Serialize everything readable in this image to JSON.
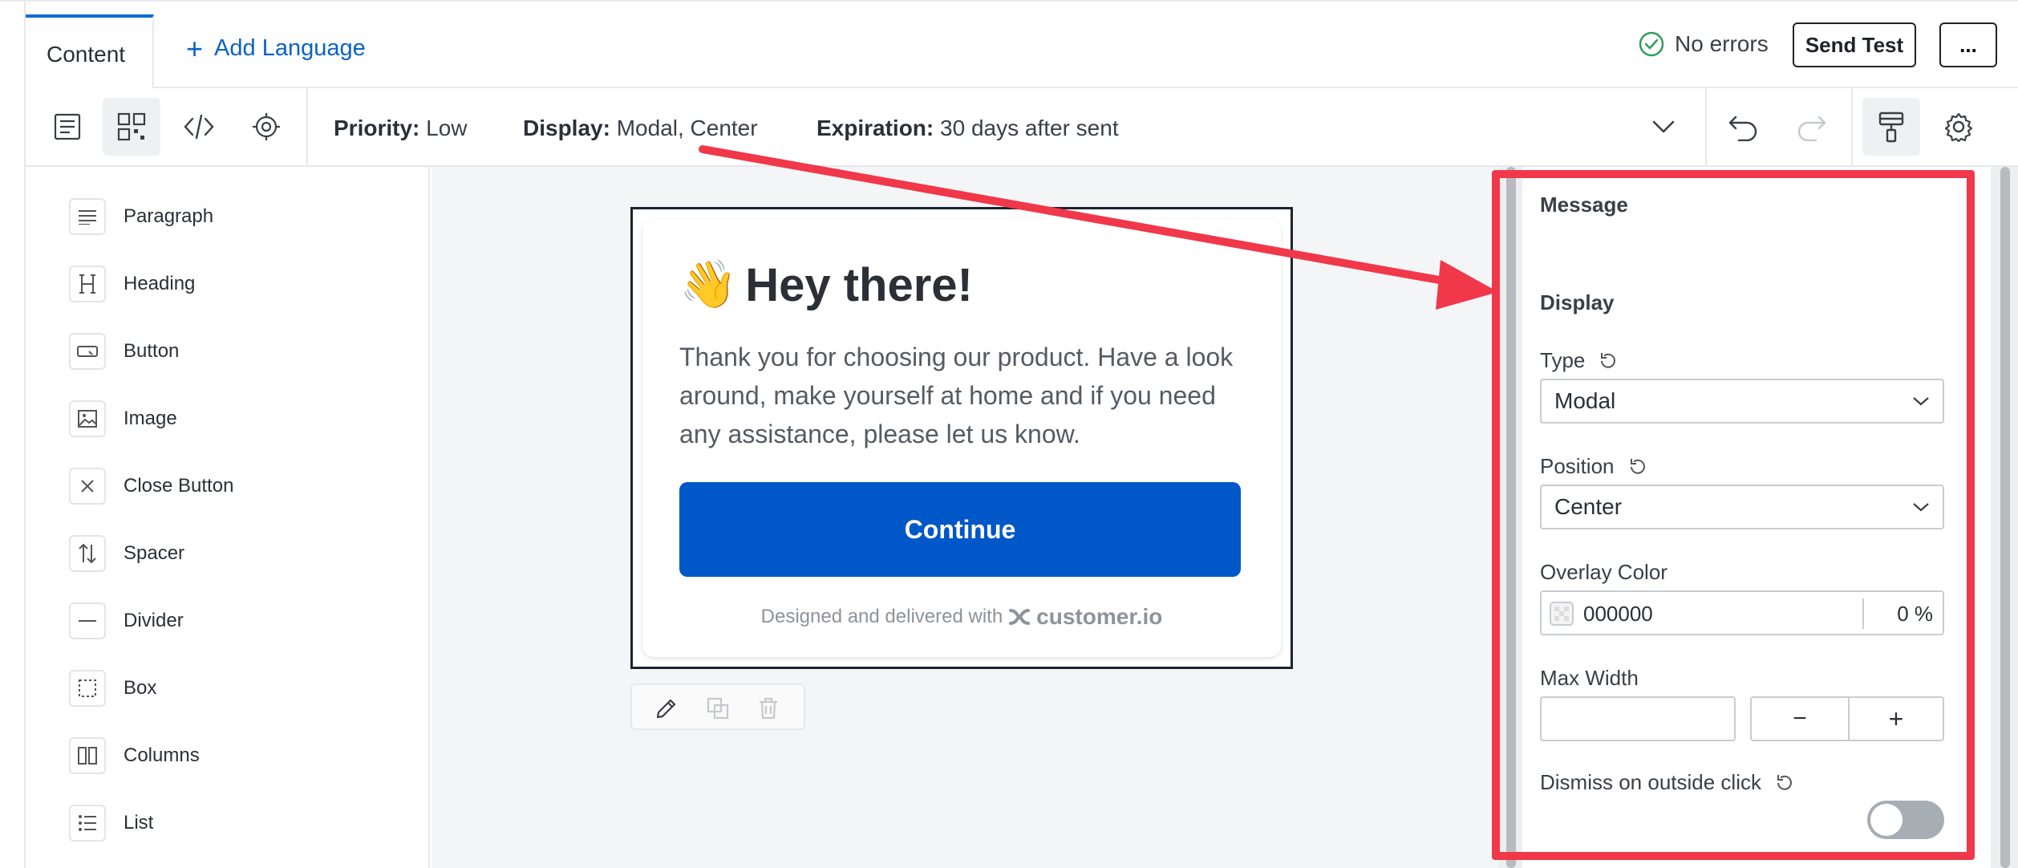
{
  "header": {
    "tab_content": "Content",
    "add_language": "Add Language",
    "status": "No errors",
    "send_test": "Send Test",
    "more": "..."
  },
  "toolbar": {
    "priority_label": "Priority:",
    "priority_value": "Low",
    "display_label": "Display:",
    "display_value": "Modal, Center",
    "expiration_label": "Expiration:",
    "expiration_value": "30 days after sent",
    "icons": [
      "document-icon",
      "grid-blocks-icon",
      "code-icon",
      "target-icon",
      "chevron-down-icon",
      "undo-icon",
      "redo-icon",
      "paint-roller-icon",
      "gear-icon"
    ]
  },
  "palette": {
    "items": [
      {
        "label": "Paragraph",
        "icon": "paragraph-icon"
      },
      {
        "label": "Heading",
        "icon": "heading-icon"
      },
      {
        "label": "Button",
        "icon": "button-icon"
      },
      {
        "label": "Image",
        "icon": "image-icon"
      },
      {
        "label": "Close Button",
        "icon": "close-icon"
      },
      {
        "label": "Spacer",
        "icon": "spacer-icon"
      },
      {
        "label": "Divider",
        "icon": "divider-icon"
      },
      {
        "label": "Box",
        "icon": "box-icon"
      },
      {
        "label": "Columns",
        "icon": "columns-icon"
      },
      {
        "label": "List",
        "icon": "list-icon"
      }
    ]
  },
  "modal": {
    "emoji": "👋",
    "title": "Hey there!",
    "body": "Thank you for choosing our product. Have a look around, make yourself at home and if you need any assistance, please let us know.",
    "button": "Continue",
    "footer": "Designed and delivered with",
    "brand": "customer.io"
  },
  "panel": {
    "section_message": "Message",
    "section_display": "Display",
    "type_label": "Type",
    "type_value": "Modal",
    "position_label": "Position",
    "position_value": "Center",
    "overlay_label": "Overlay Color",
    "overlay_value": "000000",
    "overlay_opacity": "0 %",
    "max_width_label": "Max Width",
    "max_width_value": "",
    "minus": "−",
    "plus": "+",
    "dismiss_label": "Dismiss on outside click",
    "dismiss_enabled": false
  },
  "colors": {
    "accent": "#0b62c4",
    "button": "#0057c7",
    "highlight": "#f0384a",
    "status_ok": "#2e9e5b"
  }
}
